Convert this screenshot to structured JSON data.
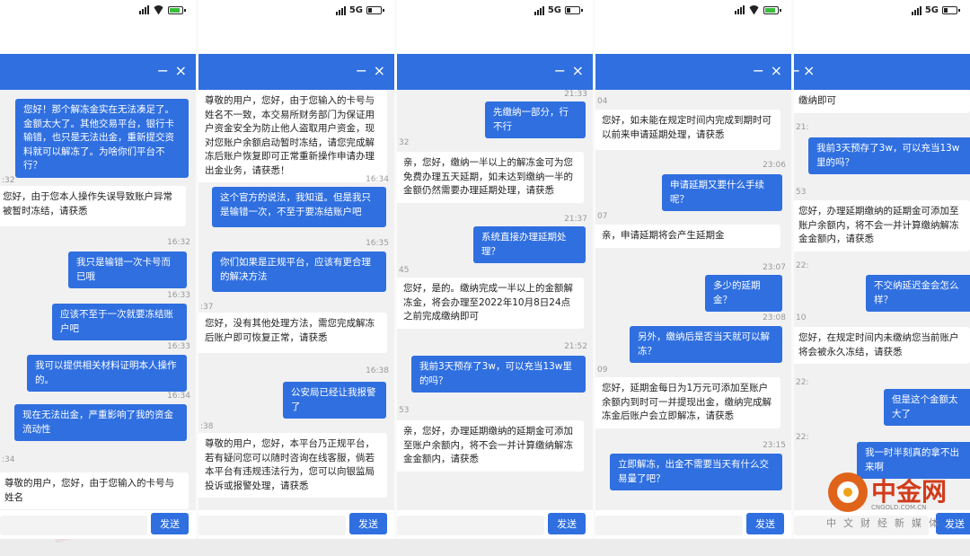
{
  "theme": {
    "accent": "#2f6fe0",
    "background": "#f1f1f1"
  },
  "phones": [
    {
      "status": {
        "net": "",
        "battery": "charging"
      },
      "header": {
        "minimize": "−",
        "close": "×"
      },
      "messages": [
        {
          "from": "me",
          "text": "您好！那个解冻金实在无法凑足了。金额太大了。其他交易平台，银行卡输错，也只是无法出金，重新提交资料就可以解冻了。为啥你们平台不行？"
        },
        {
          "time": ":32"
        },
        {
          "from": "them",
          "text": "您好，由于您本人操作失误导致账户异常被暂时冻结，请获悉"
        },
        {
          "time": "16:32"
        },
        {
          "from": "me",
          "text": "我只是输错一次卡号而已哦"
        },
        {
          "time": "16:33"
        },
        {
          "from": "me",
          "text": "应该不至于一次就要冻结账户吧"
        },
        {
          "time": "16:33"
        },
        {
          "from": "me",
          "text": "我可以提供相关材料证明本人操作的。"
        },
        {
          "time": "16:34"
        },
        {
          "from": "me",
          "text": "现在无法出金，严重影响了我的资金流动性"
        },
        {
          "time": ":34"
        },
        {
          "from": "them",
          "text": "尊敬的用户，您好，由于您输入的卡号与姓名"
        }
      ],
      "send_label": "发送"
    },
    {
      "status": {
        "net": "5G",
        "battery": "normal"
      },
      "header": {
        "minimize": "−",
        "close": "×"
      },
      "messages": [
        {
          "from": "them",
          "text": "尊敬的用户，您好，由于您输入的卡号与姓名不一致，本交易所财务部门为保证用户资金安全为防止他人盗取用户资金，现对您账户余额启动暂时冻结，请您完成解冻后账户恢复即可正常重新操作申请办理出金业务，请获悉！"
        },
        {
          "time": "16:34"
        },
        {
          "from": "me",
          "text": "这个官方的说法，我知道。但是我只是输错一次，不至于要冻结账户吧"
        },
        {
          "time": "16:35"
        },
        {
          "from": "me",
          "text": "你们如果是正规平台，应该有更合理的解决方法"
        },
        {
          "time": ":37"
        },
        {
          "from": "them",
          "text": "您好，没有其他处理方法，需您完成解冻后账户即可恢复正常，请获悉"
        },
        {
          "time": "16:38"
        },
        {
          "from": "me",
          "text": "公安局已经让我报警了"
        },
        {
          "time": ":38"
        },
        {
          "from": "them",
          "text": "尊敬的用户，您好，本平台乃正规平台，若有疑问您可以随时咨询在线客服，倘若本平台有违规违法行为，您可以向银监局投诉或报警处理，请获悉"
        }
      ],
      "send_label": "发送"
    },
    {
      "status": {
        "net": "5G",
        "battery": "normal"
      },
      "header": {
        "minimize": "−",
        "close": "×"
      },
      "messages": [
        {
          "time": "21:33"
        },
        {
          "from": "me",
          "text": "先缴纳一部分，行不行"
        },
        {
          "time": "32"
        },
        {
          "from": "them",
          "text": "亲，您好，缴纳一半以上的解冻金可为您免费办理五天延期，如未达到缴纳一半的金额仍然需要办理延期处理，请获悉"
        },
        {
          "time": "21:37"
        },
        {
          "from": "me",
          "text": "系统直接办理延期处理？"
        },
        {
          "time": "45"
        },
        {
          "from": "them",
          "text": "您好，是的。缴纳完成一半以上的金额解冻金，将会办理至2022年10月8日24点之前完成缴纳即可"
        },
        {
          "time": "21:52"
        },
        {
          "from": "me",
          "text": "我前3天预存了3w，可以充当13w里的吗？"
        },
        {
          "time": "53"
        },
        {
          "from": "them",
          "text": "亲，您好，办理延期缴纳的延期金可添加至账户余额内，将不会一并计算缴纳解冻金金额内，请获悉"
        }
      ],
      "send_label": "发送"
    },
    {
      "status": {
        "net": "",
        "battery": "charging"
      },
      "header": {
        "minimize": "−",
        "close": "×"
      },
      "messages": [
        {
          "time": "04"
        },
        {
          "from": "them",
          "text": "您好，如未能在规定时间内完成到期时可以前来申请延期处理，请获悉"
        },
        {
          "time": "23:06"
        },
        {
          "from": "me",
          "text": "申请延期又要什么手续呢？"
        },
        {
          "time": "07"
        },
        {
          "from": "them",
          "text": "亲，申请延期将会产生延期金"
        },
        {
          "time": "23:07"
        },
        {
          "from": "me",
          "text": "多少的延期金？"
        },
        {
          "time": "23:08"
        },
        {
          "from": "me",
          "text": "另外，缴纳后是否当天就可以解冻？"
        },
        {
          "time": "09"
        },
        {
          "from": "them",
          "text": "您好，延期金每日为1万元可添加至账户余额内到时可一并提现出金，缴纳完成解冻金后账户会立即解冻，请获悉"
        },
        {
          "time": "23:15"
        },
        {
          "from": "me",
          "text": "立即解冻，出金不需要当天有什么交易量了吧？"
        }
      ],
      "send_label": "发送"
    },
    {
      "status": {
        "net": "5G",
        "battery": "normal"
      },
      "header": {
        "minimize": "−",
        "close": "×"
      },
      "messages": [
        {
          "from": "them",
          "text": "缴纳即可"
        },
        {
          "time": "21:"
        },
        {
          "from": "me",
          "text": "我前3天预存了3w，可以充当13w里的吗？"
        },
        {
          "time": "53"
        },
        {
          "from": "them",
          "text": "您好，办理延期缴纳的延期金可添加至账户余额内，将不会一并计算缴纳解冻金金额内，请获悉"
        },
        {
          "time": "22:"
        },
        {
          "from": "me",
          "text": "不交纳延迟金会怎么样？"
        },
        {
          "time": "10"
        },
        {
          "from": "them",
          "text": "您好，在规定时间内未缴纳您当前账户将会被永久冻结，请获悉"
        },
        {
          "time": "22:"
        },
        {
          "from": "me",
          "text": "但是这个金额太大了"
        },
        {
          "time": "22:"
        },
        {
          "from": "me",
          "text": "我一时半刻真的拿不出来啊"
        }
      ],
      "send_label": "发送"
    }
  ],
  "logo": {
    "name": "中金网",
    "url": "CNGOLD.COM.CN",
    "slogan": "中文财经新媒体"
  }
}
